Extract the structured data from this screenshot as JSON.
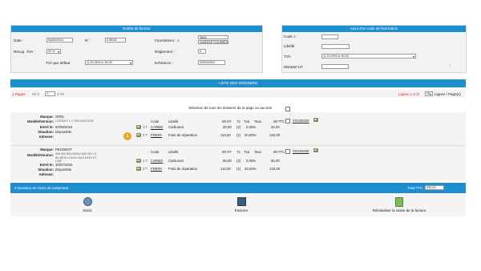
{
  "facture_panel": {
    "title": "Entête de facture",
    "date_label": "Date :",
    "date_value": "04/08/2024",
    "no_label": "N° :",
    "no_value": "078094",
    "fournisseur_label": "Fournisseur :",
    "fournisseur_code": "3684",
    "fournisseur_name": "GARAGE COURBLIN",
    "recup_tva_label": "Récup. TVA :",
    "recup_tva_value": "20 %",
    "reglement_label": "Règlement :",
    "reglement_value": "4",
    "tva_defaut_label": "TVA par défaut",
    "tva_defaut_value": "1) 20,00% le 30,00",
    "echeance_label": "Echéance :",
    "echeance_value": "03/09/2024"
  },
  "ajout_panel": {
    "title": "Ajout d'un code de facturation",
    "code_label": "Code",
    "libelle_label": "Libellé",
    "tva_label": "TVA",
    "tva_value": "1) 20,00% le 30,00",
    "montant_label": "Montant HT",
    "add_icon": "plus-icon"
  },
  "dossiers": {
    "title": "LISTE DES DOSSIERS",
    "pages_label": "1 Pages :",
    "nav_prev": "<< <",
    "page_value": "1",
    "nav_next": "> >>",
    "lignes_label": "Lignes 1-2 /2",
    "per_page_value": "20",
    "per_page_label": "Lignes / Page(s)",
    "select_all_label": "Sélection de tous les dossiers de la page ou aucune",
    "columns": [
      "Code",
      "Libellé",
      "Mt HT",
      "Tx",
      "Tva",
      "Taux",
      "Mt TTC"
    ],
    "vehicles": [
      {
        "marque_label": "Marque:",
        "marque": "OPEL",
        "modele_label": "Modèle/Version:",
        "modele": "CORSA F 1.2 75CH EDITION",
        "entree_label": "Entré le:",
        "entree": "02/08/2024",
        "situation_label": "Situation:",
        "situation": "Disponible",
        "adresse_label": "Adresse:",
        "dossier_link": "VO100429",
        "lines": [
          {
            "num": "1 T",
            "code": "CARBO",
            "libelle": "Carburant",
            "mt_ht": "20,00",
            "tx": "(2)",
            "tva": "0,00%",
            "mt_ttc": "20,00"
          },
          {
            "num": "2 T",
            "code": "FREPA",
            "libelle": "Frais de réparation",
            "mt_ht": "110,00",
            "tx": "(1)",
            "tva": "20,00%",
            "mt_ttc": "132,00"
          }
        ]
      },
      {
        "marque_label": "Marque:",
        "marque": "PEUGEOT",
        "modele_label": "Modèle/Version:",
        "modele": "308 SW NOUVEAU 308 SW 1.5 BLUEHDI 130CH S&S EAT8 GT LINE",
        "entree_label": "Entré le:",
        "entree": "30/07/2024",
        "situation_label": "Situation:",
        "situation": "Disponible",
        "adresse_label": "Adresse:",
        "dossier_link": "VO100430",
        "lines": [
          {
            "num": "1 T",
            "code": "CARBO",
            "libelle": "Carburant",
            "mt_ht": "55,00",
            "tx": "(2)",
            "tva": "0,00%",
            "mt_ttc": "55,00"
          },
          {
            "num": "2 T",
            "code": "FREPA",
            "libelle": "Frais de réparation",
            "mt_ht": "110,00",
            "tx": "(1)",
            "tva": "20,00%",
            "mt_ttc": "132,00"
          }
        ]
      }
    ],
    "badge_value": "1"
  },
  "footer": {
    "status": "2 Dossiers en cours de traitement",
    "total_label": "Total TTC :",
    "total_value": "339,00",
    "actions": [
      {
        "label": "Stock",
        "icon": "stock-icon"
      },
      {
        "label": "Facturer",
        "icon": "invoice-icon"
      },
      {
        "label": "Réinitialiser la saisie de la facture",
        "icon": "reset-icon"
      }
    ]
  },
  "colors": {
    "accent": "#1d8fcf",
    "alert": "#d11a1a",
    "badge": "#f0a21b",
    "link": "#1a5fb4"
  }
}
